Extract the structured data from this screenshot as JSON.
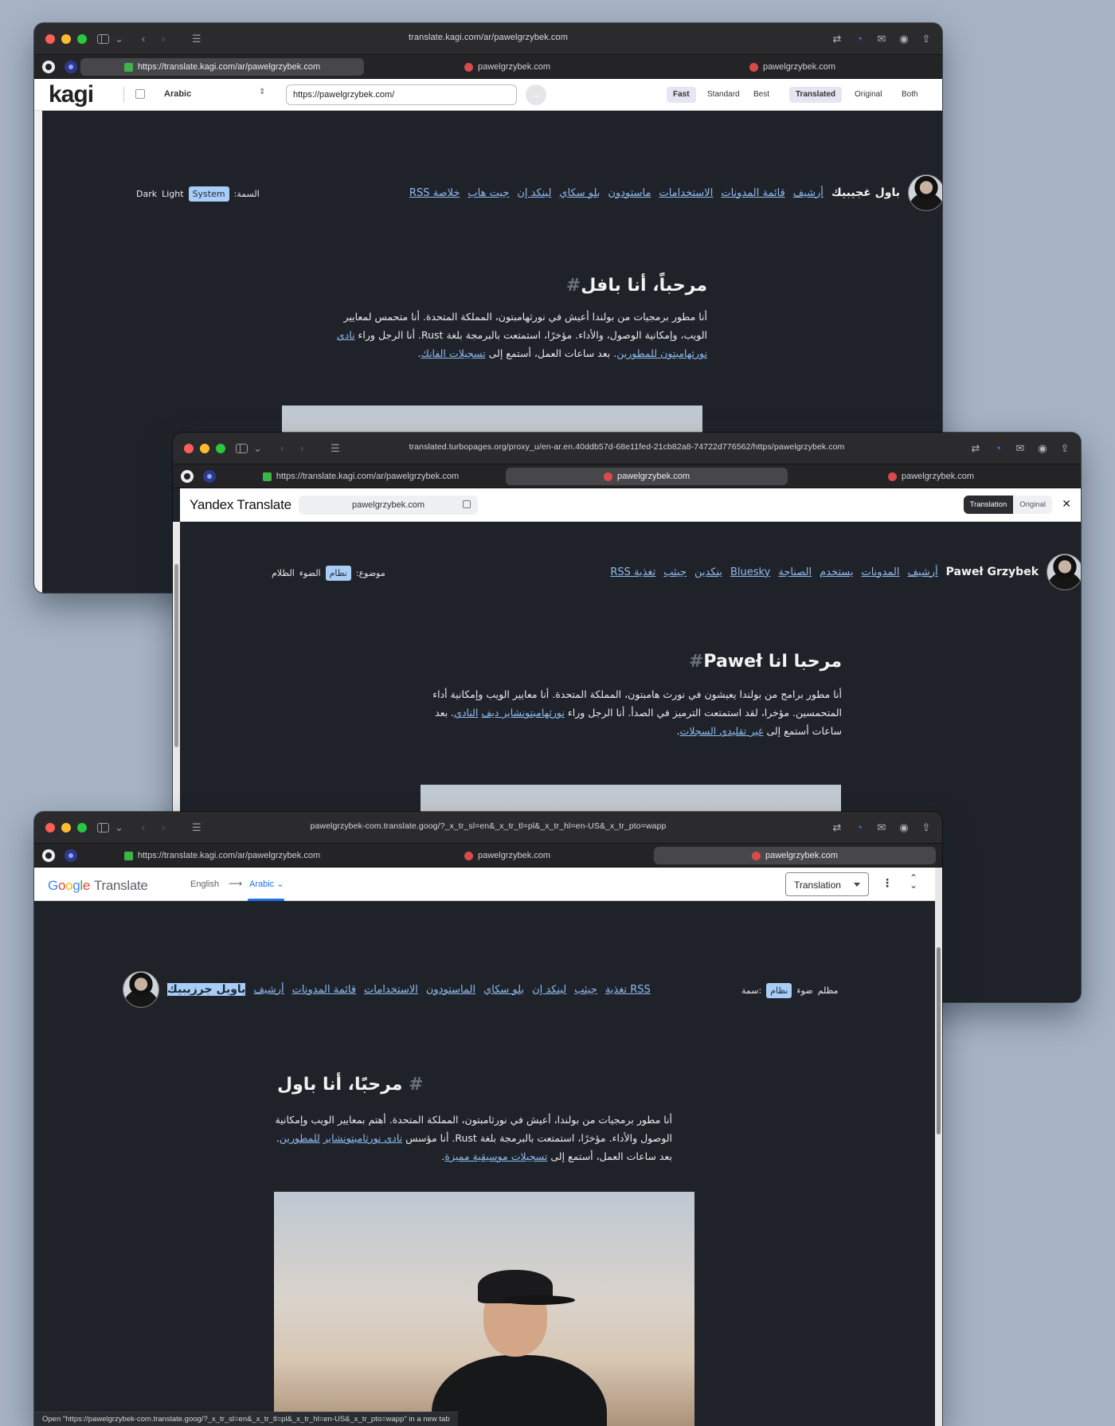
{
  "window1": {
    "address": "translate.kagi.com/ar/pawelgrzybek.com",
    "tabs": [
      "https://translate.kagi.com/ar/pawelgrzybek.com",
      "pawelgrzybek.com",
      "pawelgrzybek.com"
    ],
    "kagi": {
      "logo": "kagi",
      "language": "Arabic",
      "url_value": "https://pawelgrzybek.com/",
      "quality": [
        "Fast",
        "Standard",
        "Best"
      ],
      "view": [
        "Translated",
        "Original",
        "Both"
      ]
    },
    "site": {
      "name": "باول غجيبيك",
      "nav": [
        "أرشيف",
        "قائمة المدونات",
        "الاستخدامات",
        "ماستودون",
        "بلو سكاي",
        "لينكد إن",
        "جيت هاب",
        "خلاصة RSS"
      ],
      "theme_label": "السمة:",
      "theme": [
        "System",
        "Light",
        "Dark"
      ],
      "heading": "مرحباً، أنا بافل",
      "hash": "#",
      "para_1": "أنا مطور برمجيات من بولندا أعيش في نورثهامبتون، المملكة المتحدة. أنا متحمس لمعايير الويب، وإمكانية الوصول، والأداء. مؤخرًا، استمتعت بالبرمجة بلغة Rust. أنا الرجل وراء",
      "link_1": "نادي",
      "link_2": "نورثهامبتون للمطورين",
      "para_2": ". بعد ساعات العمل، أستمع إلى",
      "link_3": "تسجيلات الفانك",
      "para_3": "."
    }
  },
  "window2": {
    "address": "translated.turbopages.org/proxy_u/en-ar.en.40ddb57d-68e11fed-21cb82a8-74722d776562/https/pawelgrzybek.com",
    "tabs": [
      "https://translate.kagi.com/ar/pawelgrzybek.com",
      "pawelgrzybek.com",
      "pawelgrzybek.com"
    ],
    "yandex": {
      "logo": "Yandex Translate",
      "url": "pawelgrzybek.com",
      "toggle": [
        "Translation",
        "Original"
      ],
      "close": "✕"
    },
    "site": {
      "name": "Paweł Grzybek",
      "nav": [
        "أرشيف",
        "المدونات",
        "يستخدم",
        "الصناجة",
        "Bluesky",
        "ينكدين",
        "جيثب",
        "تغذية RSS"
      ],
      "theme_label": "موضوع:",
      "theme": [
        "نظام",
        "الضوء",
        "الظلام"
      ],
      "heading": "مرحبا انا Paweł",
      "hash": "#",
      "para_1": "أنا مطور برامج من بولندا يعيشون في نورث هامبتون، المملكة المتحدة. أنا معايير الويب وإمكانية أداء المتحمسين. مؤخرا، لقد استمتعت الترميز في الصدأ. أنا الرجل وراء",
      "link_1": "نورثهامبتونشاير ديف",
      "link_2": "النادي",
      "para_2": ". بعد ساعات أستمع إلى",
      "link_3": "غير تقليدي السجلات",
      "para_3": "."
    }
  },
  "window3": {
    "address": "pawelgrzybek-com.translate.goog/?_x_tr_sl=en&_x_tr_tl=pl&_x_tr_hl=en-US&_x_tr_pto=wapp",
    "tabs": [
      "https://translate.kagi.com/ar/pawelgrzybek.com",
      "pawelgrzybek.com",
      "pawelgrzybek.com"
    ],
    "google": {
      "logo_parts": [
        "G",
        "o",
        "o",
        "g",
        "l",
        "e"
      ],
      "product": "Translate",
      "source": "English",
      "arrow": "⟶",
      "target": "Arabic",
      "mode": "Translation"
    },
    "site": {
      "name": "باويل جرزيبيك",
      "nav": [
        "أرشيف",
        "قائمة المدونات",
        "الاستخدامات",
        "الماستودون",
        "بلو سكاي",
        "لينكد إن",
        "جيثب",
        "تغذية RSS"
      ],
      "theme_label": "سمة:",
      "theme": [
        "نظام",
        "ضوء",
        "مظلم"
      ],
      "heading": "مرحبًا، أنا باول",
      "hash": "#",
      "para_1": "أنا مطور برمجيات من بولندا، أعيش في نورثامبتون، المملكة المتحدة. أهتم بمعايير الويب وإمكانية الوصول والأداء. مؤخرًا، استمتعت بالبرمجة بلغة Rust. أنا مؤسس",
      "link_1": "نادي نورثامبتونشاير",
      "link_2": "للمطورين",
      "para_2": ". بعد ساعات العمل، أستمع إلى",
      "link_3": "تسجيلات موسيقية مميزة",
      "para_3": "."
    },
    "status": "Open \"https://pawelgrzybek-com.translate.goog/?_x_tr_sl=en&_x_tr_tl=pl&_x_tr_hl=en-US&_x_tr_pto=wapp\" in a new tab"
  }
}
